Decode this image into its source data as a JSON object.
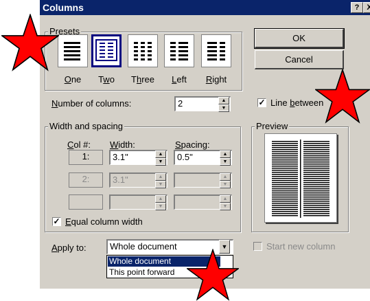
{
  "window": {
    "title": "Columns",
    "help_btn": "?",
    "close_btn": "X"
  },
  "presets": {
    "group_label": "Presets",
    "items": [
      {
        "label": "One",
        "accel": "O",
        "rest": "ne"
      },
      {
        "label": "Two",
        "accel": "w",
        "pre": "T",
        "rest": "o"
      },
      {
        "label": "Three",
        "accel": "h",
        "pre": "T",
        "rest": "ree"
      },
      {
        "label": "Left",
        "accel": "L",
        "rest": "eft"
      },
      {
        "label": "Right",
        "accel": "R",
        "rest": "ight"
      }
    ],
    "selected": "Two"
  },
  "buttons": {
    "ok": "OK",
    "cancel": "Cancel"
  },
  "num_columns": {
    "label_pre": "N",
    "label_rest": "umber of columns:",
    "value": "2"
  },
  "line_between": {
    "label_pre": "Line ",
    "label_accel": "b",
    "label_rest": "etween",
    "checked": true
  },
  "width_spacing": {
    "group_label": "Width and spacing",
    "col_header_pre": "C",
    "col_header_rest": "ol #:",
    "width_header_pre": "W",
    "width_header_rest": "idth:",
    "spacing_header_pre": "S",
    "spacing_header_rest": "pacing:",
    "rows": [
      {
        "col": "1:",
        "width": "3.1\"",
        "spacing": "0.5\"",
        "enabled": true
      },
      {
        "col": "2:",
        "width": "3.1\"",
        "spacing": "",
        "enabled": false
      },
      {
        "col": "",
        "width": "",
        "spacing": "",
        "enabled": false
      }
    ]
  },
  "equal_width": {
    "label_pre": "E",
    "label_rest": "qual column width",
    "checked": true
  },
  "preview": {
    "label": "Preview"
  },
  "apply_to": {
    "label_pre": "A",
    "label_rest": "pply to:",
    "value": "Whole document",
    "options": [
      "Whole document",
      "This point forward"
    ]
  },
  "start_new_column": {
    "label": "Start new column",
    "checked": false
  }
}
